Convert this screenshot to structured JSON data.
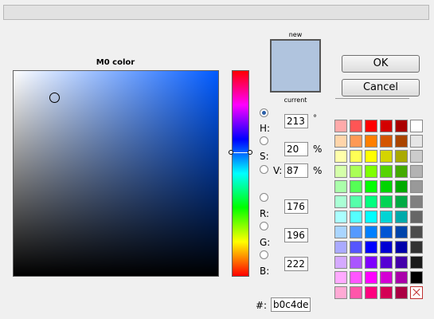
{
  "dialog": {
    "title": "M0 color",
    "new_label": "new",
    "current_label": "current",
    "ok_label": "OK",
    "cancel_label": "Cancel",
    "color_hex": "#b0c4de"
  },
  "fields": {
    "h": {
      "label": "H:",
      "value": "213",
      "unit": "°",
      "selected": true
    },
    "s": {
      "label": "S:",
      "value": "20",
      "unit": "%"
    },
    "v": {
      "label": "V:",
      "value": "87",
      "unit": "%"
    },
    "r": {
      "label": "R:",
      "value": "176"
    },
    "g": {
      "label": "G:",
      "value": "196"
    },
    "b": {
      "label": "B:",
      "value": "222"
    },
    "hex": {
      "label": "#:",
      "value": "b0c4de"
    }
  },
  "palette": [
    [
      "#ffaaaa",
      "#ff5555",
      "#ff0000",
      "#d40000",
      "#aa0000",
      "#ffffff"
    ],
    [
      "#ffd5aa",
      "#ff9955",
      "#ff7f00",
      "#d45500",
      "#aa4400",
      "#e6e6e6"
    ],
    [
      "#ffffaa",
      "#ffff55",
      "#ffff00",
      "#d4d400",
      "#aaaa00",
      "#cccccc"
    ],
    [
      "#d5ffaa",
      "#aaff55",
      "#7fff00",
      "#55d400",
      "#44aa00",
      "#b3b3b3"
    ],
    [
      "#aaffaa",
      "#55ff55",
      "#00ff00",
      "#00d400",
      "#00aa00",
      "#999999"
    ],
    [
      "#aaffd5",
      "#55ffaa",
      "#00ff7f",
      "#00d455",
      "#00aa44",
      "#808080"
    ],
    [
      "#aaffff",
      "#55ffff",
      "#00ffff",
      "#00d4d4",
      "#00aaaa",
      "#666666"
    ],
    [
      "#aad5ff",
      "#5599ff",
      "#007fff",
      "#0055d4",
      "#0044aa",
      "#4d4d4d"
    ],
    [
      "#aaaaff",
      "#5555ff",
      "#0000ff",
      "#0000d4",
      "#0000aa",
      "#333333"
    ],
    [
      "#d5aaff",
      "#aa55ff",
      "#7f00ff",
      "#5500d4",
      "#4400aa",
      "#1a1a1a"
    ],
    [
      "#ffaaff",
      "#ff55ff",
      "#ff00ff",
      "#d400d4",
      "#aa00aa",
      "#000000"
    ],
    [
      "#ffaad5",
      "#ff55aa",
      "#ff007f",
      "#d40055",
      "#aa0044",
      "clear"
    ]
  ]
}
